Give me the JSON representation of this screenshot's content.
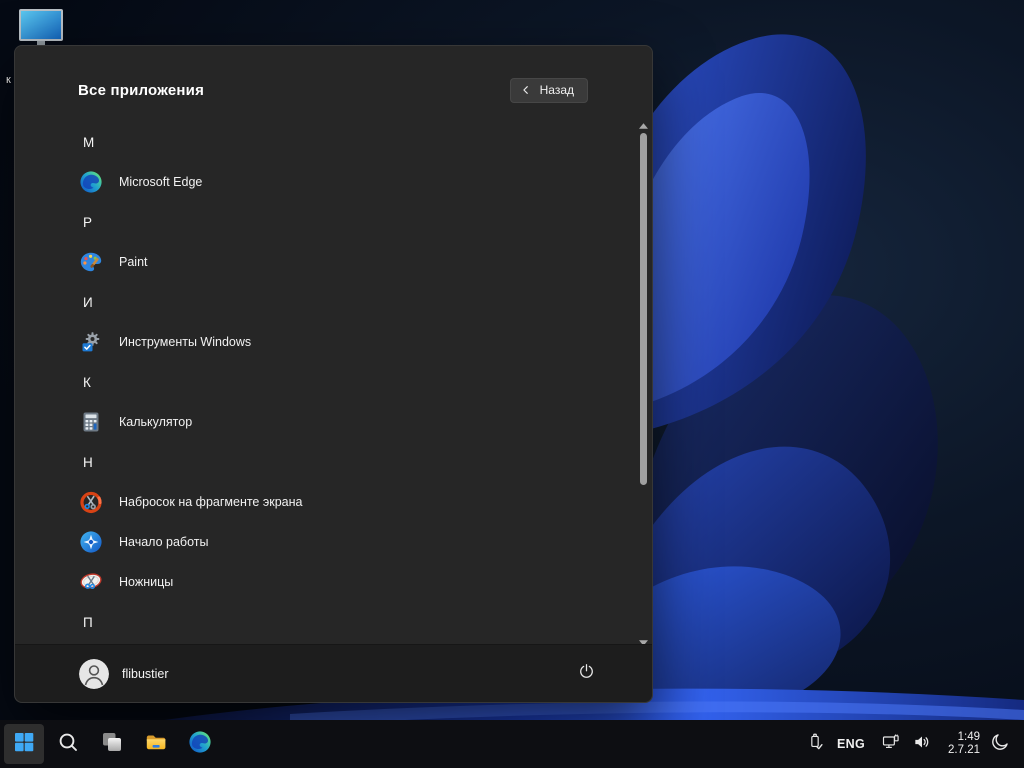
{
  "desktop": {
    "this_pc_icon": "this-pc-icon",
    "partial_icon_label": "к"
  },
  "start_menu": {
    "title": "Все приложения",
    "back_button_label": "Назад",
    "sections": [
      {
        "letter": "M",
        "apps": [
          {
            "name": "Microsoft Edge",
            "icon": "edge-icon"
          }
        ]
      },
      {
        "letter": "P",
        "apps": [
          {
            "name": "Paint",
            "icon": "paint-icon"
          }
        ]
      },
      {
        "letter": "И",
        "apps": [
          {
            "name": "Инструменты Windows",
            "icon": "windows-tools-icon"
          }
        ]
      },
      {
        "letter": "К",
        "apps": [
          {
            "name": "Калькулятор",
            "icon": "calculator-icon"
          }
        ]
      },
      {
        "letter": "Н",
        "apps": [
          {
            "name": "Набросок на фрагменте экрана",
            "icon": "snip-sketch-icon"
          },
          {
            "name": "Начало работы",
            "icon": "get-started-icon"
          },
          {
            "name": "Ножницы",
            "icon": "snipping-tool-icon"
          }
        ]
      },
      {
        "letter": "П",
        "apps": []
      }
    ],
    "user": {
      "name": "flibustier"
    }
  },
  "taskbar": {
    "buttons": [
      "start",
      "search",
      "task-view",
      "file-explorer",
      "edge"
    ],
    "tray": {
      "language": "ENG",
      "time": "1:49",
      "date": "2.7.21"
    }
  },
  "colors": {
    "accent_blue": "#3fa9f5",
    "menu_background": "#262626",
    "user_bar_background": "#1d1d1d",
    "taskbar_background": "#0d0e12",
    "wallpaper_petal_bright": "#3261ec",
    "wallpaper_base": "#0a1322"
  }
}
